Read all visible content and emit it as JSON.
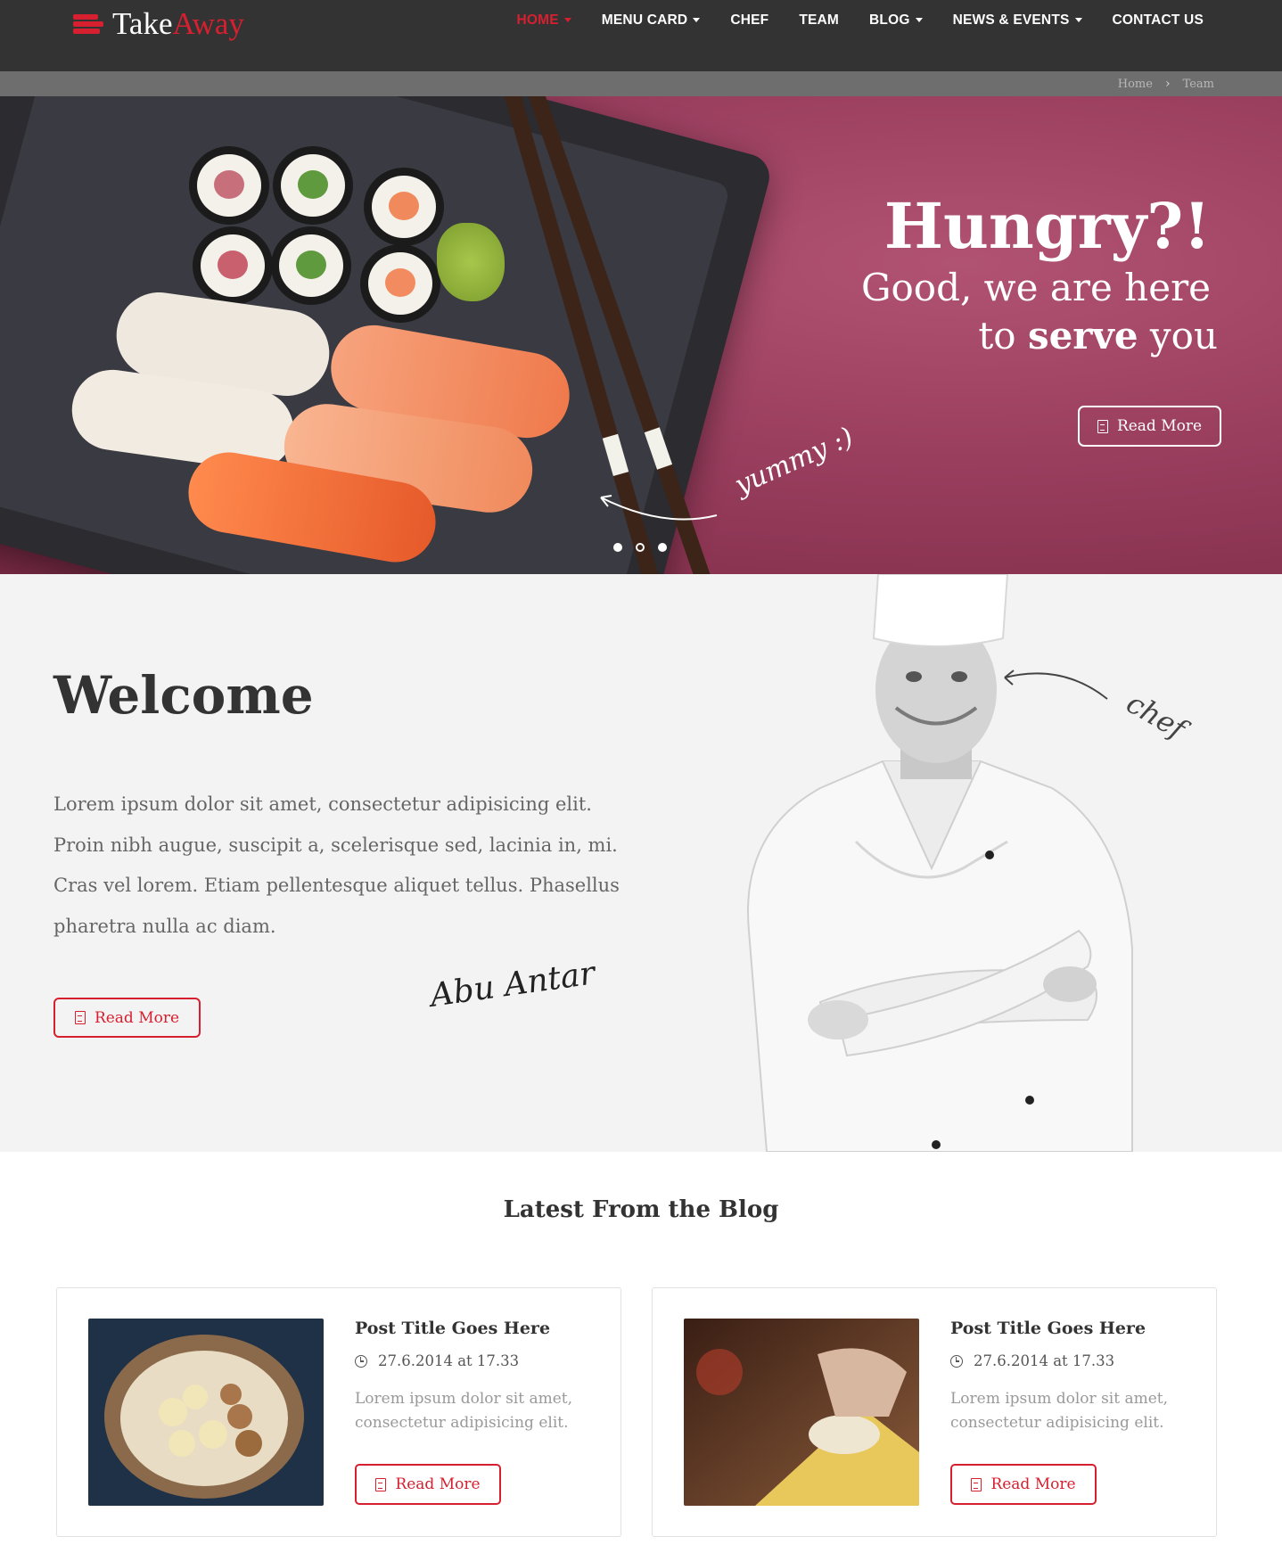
{
  "brand": {
    "name_part1": "Take",
    "name_part2": "Away",
    "accent_color": "#d6202f"
  },
  "nav": {
    "items": [
      {
        "label": "HOME",
        "active": true,
        "dropdown": true
      },
      {
        "label": "MENU CARD",
        "active": false,
        "dropdown": true
      },
      {
        "label": "CHEF",
        "active": false,
        "dropdown": false
      },
      {
        "label": "TEAM",
        "active": false,
        "dropdown": false
      },
      {
        "label": "BLOG",
        "active": false,
        "dropdown": true
      },
      {
        "label": "NEWS & EVENTS",
        "active": false,
        "dropdown": true
      },
      {
        "label": "CONTACT US",
        "active": false,
        "dropdown": false
      }
    ]
  },
  "breadcrumb": {
    "items": [
      "Home",
      "Team"
    ],
    "separator": "chevron-right-icon"
  },
  "hero": {
    "title": "Hungry?!",
    "subtitle_line1": "Good, we are here",
    "subtitle_to": "to",
    "subtitle_bold": "serve",
    "subtitle_end": "you",
    "annotation": "yummy :)",
    "button_label": "Read More",
    "button_icon": "document-icon",
    "slider": {
      "total": 3,
      "active_index": 1
    },
    "background_color": "#9a3e5e"
  },
  "welcome": {
    "title": "Welcome",
    "text": "Lorem ipsum dolor sit amet, consectetur adipisicing elit. Proin nibh augue, suscipit a, scelerisque sed, lacinia in, mi. Cras vel lorem. Etiam pellentesque aliquet tellus. Phasellus pharetra nulla ac diam.",
    "button_label": "Read More",
    "signature": "Abu Antar",
    "chef_annotation": "chef"
  },
  "blog": {
    "title": "Latest From the Blog",
    "posts": [
      {
        "title": "Post Title Goes Here",
        "date": "27.6.2014  at  17.33",
        "excerpt": "Lorem ipsum dolor sit amet, consectetur adipisicing elit.",
        "button_label": "Read More"
      },
      {
        "title": "Post Title Goes Here",
        "date": "27.6.2014  at  17.33",
        "excerpt": "Lorem ipsum dolor sit amet, consectetur adipisicing elit.",
        "button_label": "Read More"
      }
    ]
  }
}
